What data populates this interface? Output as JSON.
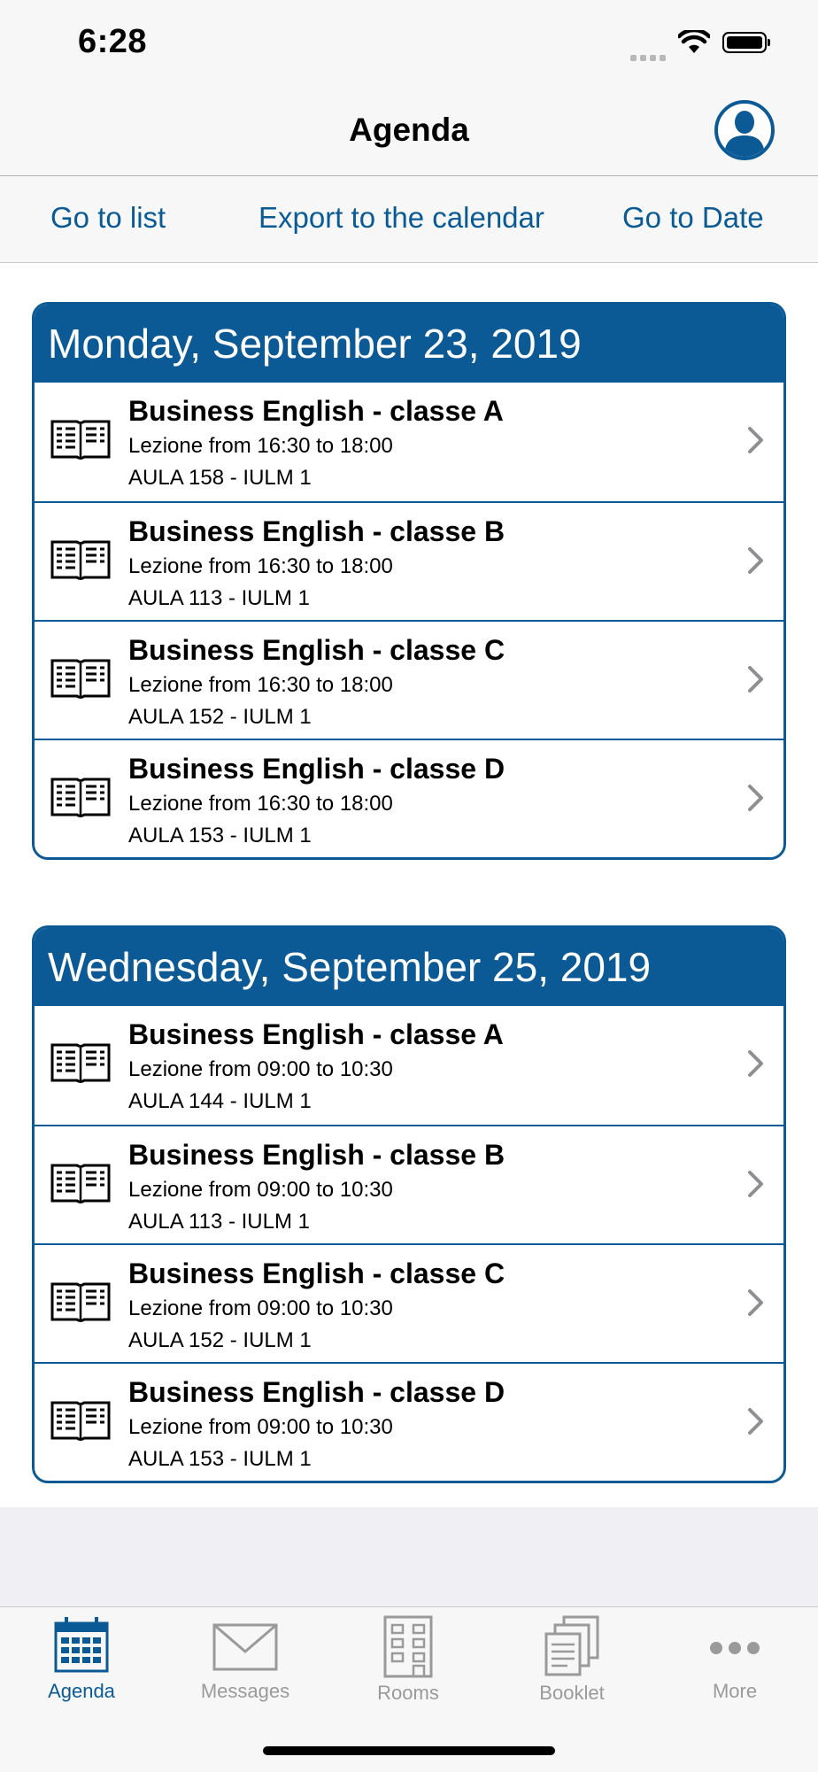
{
  "status": {
    "time": "6:28"
  },
  "nav": {
    "title": "Agenda"
  },
  "toolbar": {
    "go_list": "Go to list",
    "export": "Export to the calendar",
    "go_date": "Go to Date"
  },
  "days": [
    {
      "date": "Monday, September 23, 2019",
      "items": [
        {
          "title": "Business English - classe A",
          "time": "Lezione from 16:30 to 18:00",
          "room": "AULA 158 - IULM 1"
        },
        {
          "title": "Business English - classe B",
          "time": "Lezione from 16:30 to 18:00",
          "room": "AULA 113 - IULM 1"
        },
        {
          "title": "Business English - classe C",
          "time": "Lezione from 16:30 to 18:00",
          "room": "AULA 152 - IULM 1"
        },
        {
          "title": "Business English - classe D",
          "time": "Lezione from 16:30 to 18:00",
          "room": "AULA 153 - IULM 1"
        }
      ]
    },
    {
      "date": "Wednesday, September 25, 2019",
      "items": [
        {
          "title": "Business English - classe A",
          "time": "Lezione from 09:00 to 10:30",
          "room": "AULA 144 - IULM 1"
        },
        {
          "title": "Business English - classe B",
          "time": "Lezione from 09:00 to 10:30",
          "room": "AULA 113 - IULM 1"
        },
        {
          "title": "Business English - classe C",
          "time": "Lezione from 09:00 to 10:30",
          "room": "AULA 152 - IULM 1"
        },
        {
          "title": "Business English - classe D",
          "time": "Lezione from 09:00 to 10:30",
          "room": "AULA 153 - IULM 1"
        }
      ]
    }
  ],
  "tabs": [
    {
      "label": "Agenda",
      "icon": "calendar-icon",
      "active": true
    },
    {
      "label": "Messages",
      "icon": "envelope-icon",
      "active": false
    },
    {
      "label": "Rooms",
      "icon": "building-icon",
      "active": false
    },
    {
      "label": "Booklet",
      "icon": "documents-icon",
      "active": false
    },
    {
      "label": "More",
      "icon": "ellipsis-icon",
      "active": false
    }
  ],
  "colors": {
    "accent": "#0b5a95",
    "link": "#0a5a96",
    "inactive": "#9a9a9a"
  }
}
